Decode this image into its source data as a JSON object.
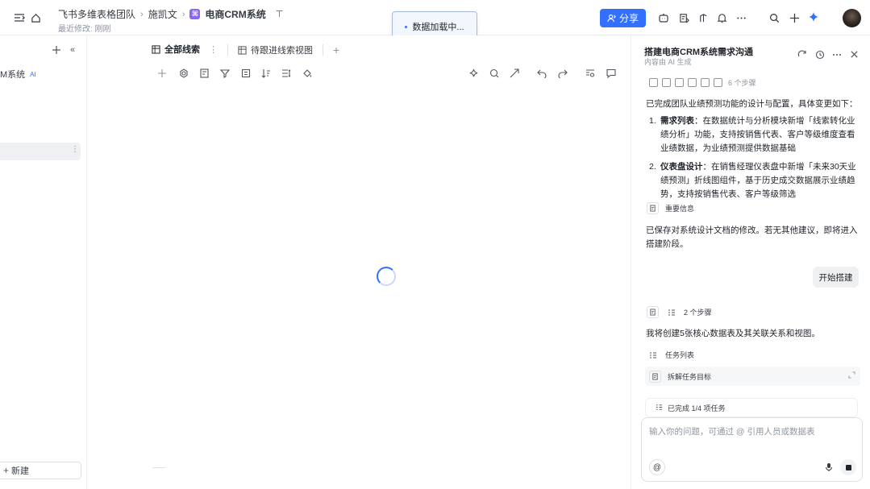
{
  "header": {
    "breadcrumbs": [
      "飞书多维表格团队",
      "施凯文",
      "电商CRM系统"
    ],
    "last_modified": "最近修改: 刚刚",
    "share_label": "分享",
    "toast": "数据加载中..."
  },
  "sidebar": {
    "partial_title": "M系统",
    "ai_badge": "AI",
    "new_label": "新建"
  },
  "table": {
    "tabs": [
      {
        "label": "全部线索",
        "active": true
      },
      {
        "label": "待跟进线索视图",
        "active": false
      }
    ]
  },
  "panel": {
    "title": "搭建电商CRM系统需求沟通",
    "subtitle": "内容由 AI 生成",
    "steps_count_top": "6 个步骤",
    "intro": "已完成团队业绩预测功能的设计与配置，具体变更如下：",
    "items": [
      {
        "num": "1.",
        "head": "需求列表",
        "body": "：在数据统计与分析模块新增「线索转化业绩分析」功能，支持按销售代表、客户等级维度查看业绩数据，为业绩预测提供数据基础"
      },
      {
        "num": "2.",
        "head": "仪表盘设计",
        "body": "：在销售经理仪表盘中新增「未来30天业绩预测」折线图组件，基于历史成交数据展示业绩趋势，支持按销售代表、客户等级筛选"
      }
    ],
    "important_info": "重要信息",
    "saved_note": "已保存对系统设计文档的修改。若无其他建议，即将进入搭建阶段。",
    "start_button": "开始搭建",
    "steps_count_2": "2 个步骤",
    "plan_text": "我将创建5张核心数据表及其关联关系和视图。",
    "task_list": "任务列表",
    "task_goal": "拆解任务目标",
    "progress": "已完成 1/4 项任务",
    "input_placeholder": "输入你的问题，可通过 @ 引用人员或数据表"
  },
  "colors": {
    "accent": "#3370ff",
    "doc_badge": "#8b67f6"
  }
}
